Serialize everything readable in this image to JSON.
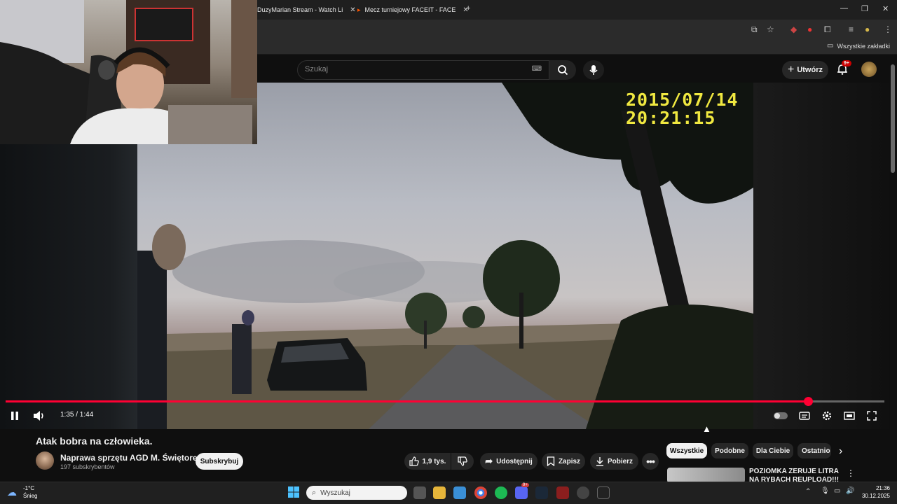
{
  "browser": {
    "tabs": [
      {
        "label": "DuzyMarian Stream - Watch Li"
      },
      {
        "label": "Mecz turniejowy FACEIT - FACE"
      }
    ],
    "bookmarks_all": "Wszystkie zakładki"
  },
  "header": {
    "search_placeholder": "Szukaj",
    "create_label": "Utwórz",
    "notifications_badge": "9+"
  },
  "video": {
    "overlay_date": "2015/07/14",
    "overlay_time": "20:21:15",
    "time_display": "1:35 / 1:44",
    "progress": 0.913
  },
  "info": {
    "title": "Atak bobra na człowieka.",
    "channel": "Naprawa sprzętu AGD M. Świętorecki",
    "subscribers": "197 subskrybentów",
    "subscribe_label": "Subskrybuj",
    "likes": "1,9 tys.",
    "share_label": "Udostępnij",
    "save_label": "Zapisz",
    "download_label": "Pobierz"
  },
  "sidebar": {
    "chips": [
      "Wszystkie",
      "Podobne",
      "Dla Ciebie",
      "Ostatnio"
    ],
    "recommendation_title": "POZIOMKA ZERUJE LITRA NA RYBACH REUPLOAD!!!"
  },
  "taskbar": {
    "weather_temp": "-1°C",
    "weather_desc": "Śnieg",
    "search_placeholder": "Wyszukaj",
    "time": "21:36",
    "date": "30.12.2025",
    "discord_badge": "9+"
  },
  "colors": {
    "accent": "#ff0033",
    "background": "#0f0f0f",
    "chip_bg": "#272727",
    "timestamp_yellow": "#f0e840"
  }
}
